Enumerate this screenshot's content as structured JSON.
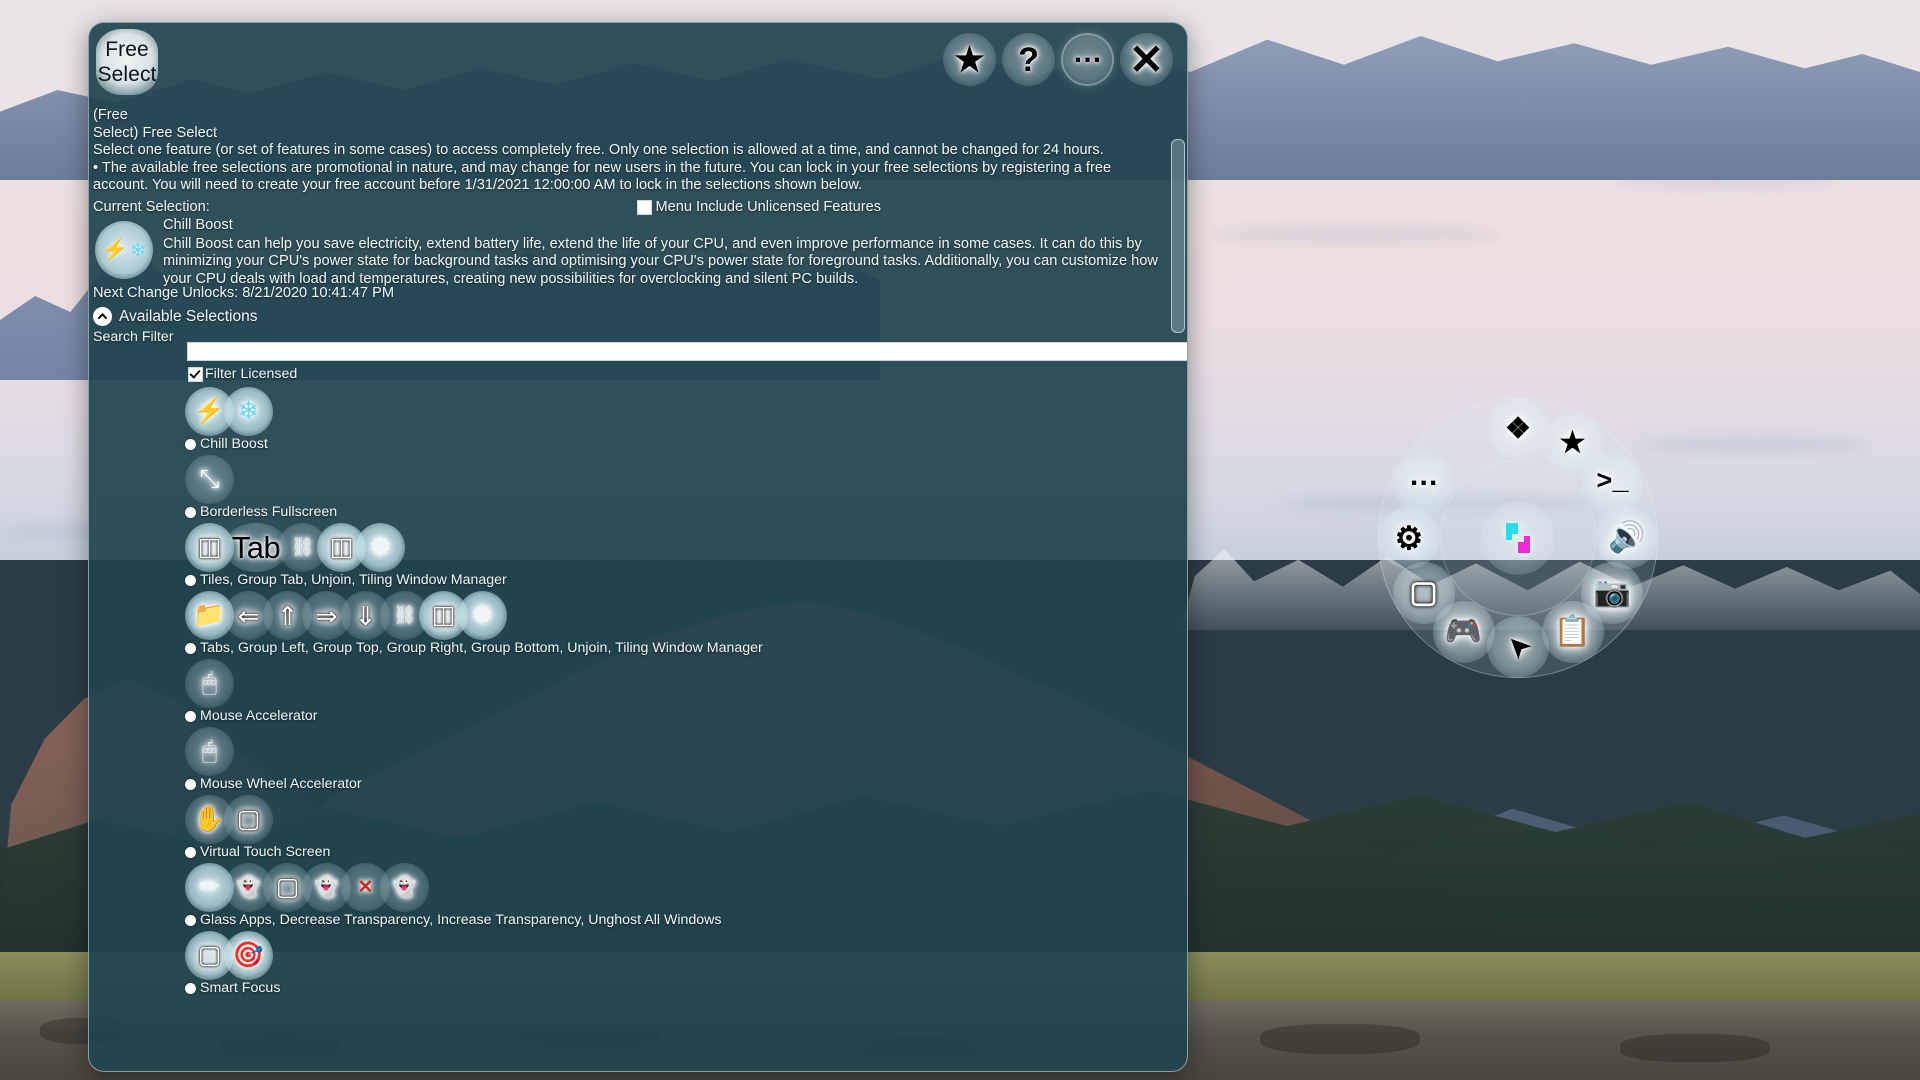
{
  "window": {
    "badge_line1": "Free",
    "badge_line2": "Select",
    "buttons": [
      {
        "name": "favorite",
        "icon": "star-icon",
        "glyph": "★"
      },
      {
        "name": "help",
        "icon": "question-mark-icon",
        "glyph": "?"
      },
      {
        "name": "more-options",
        "icon": "ellipsis-icon",
        "glyph": "…"
      },
      {
        "name": "close",
        "icon": "close-icon",
        "glyph": "✕"
      }
    ]
  },
  "intro": {
    "breadcrumb_line1": "(Free",
    "breadcrumb_line2": "Select)  Free Select",
    "description": "Select one feature (or set of features in some cases) to access completely free.  Only one selection is allowed at a time, and cannot be changed for 24 hours.",
    "bullet": "• The available free selections are promotional in nature, and may change for new users in the future.  You can lock in your free selections by registering a free account.  You will need to create your free account before 1/31/2021 12:00:00 AM to lock in the selections shown below."
  },
  "current_selection": {
    "label": "Current Selection:",
    "unlicensed_checkbox": {
      "label": "Menu Include Unlicensed Features",
      "checked": false
    },
    "item_name": "Chill Boost",
    "item_icons": [
      "lightning-bolt-icon",
      "snowflake-icon"
    ],
    "item_description": "Chill Boost can help you save electricity, extend battery life, extend the life of your CPU, and even improve performance in some cases.  It can do this by minimizing your CPU's power state for background tasks and optimising your CPU's power state for foreground tasks.  Additionally, you can customize how your CPU deals with load and temperatures, creating new possibilities for overclocking and silent PC builds.",
    "next_change": "Next Change Unlocks: 8/21/2020 10:41:47 PM"
  },
  "available": {
    "header": "Available Selections",
    "search_label": "Search Filter",
    "search_value": "",
    "search_placeholder": "",
    "filter_licensed": {
      "label": "Filter Licensed",
      "checked": true
    },
    "items": [
      {
        "label": "Chill Boost",
        "selected": false,
        "icons": [
          {
            "glyph": "⚡",
            "name": "lightning-bolt-icon",
            "bg": "light"
          },
          {
            "glyph": "❄",
            "name": "snowflake-icon",
            "bg": "light"
          }
        ]
      },
      {
        "label": "Borderless Fullscreen",
        "selected": false,
        "icons": [
          {
            "glyph": "⤡",
            "name": "diagonal-resize-arrows-icon",
            "bg": "dim"
          }
        ]
      },
      {
        "label": "Tiles, Group Tab, Unjoin, Tiling Window Manager",
        "selected": false,
        "icons": [
          {
            "glyph": "◫",
            "name": "split-panes-icon",
            "bg": "light"
          },
          {
            "glyph": "TAB-TEXT",
            "name": "tab-label-icon",
            "bg": "dim"
          },
          {
            "glyph": "⛓",
            "name": "chain-link-icon",
            "bg": "dim"
          },
          {
            "glyph": "◫",
            "name": "split-panes-icon",
            "bg": "light"
          },
          {
            "glyph": "⚙",
            "name": "gear-icon",
            "bg": "light"
          }
        ]
      },
      {
        "label": "Tabs, Group Left, Group Top, Group Right, Group Bottom, Unjoin, Tiling Window Manager",
        "selected": false,
        "icons": [
          {
            "glyph": "📁",
            "name": "folder-tabs-icon",
            "bg": "light"
          },
          {
            "glyph": "⇐",
            "name": "arrow-left-icon",
            "bg": "dim"
          },
          {
            "glyph": "⇑",
            "name": "arrow-up-icon",
            "bg": "dim"
          },
          {
            "glyph": "⇒",
            "name": "arrow-right-icon",
            "bg": "dim"
          },
          {
            "glyph": "⇓",
            "name": "arrow-down-icon",
            "bg": "dim"
          },
          {
            "glyph": "⛓",
            "name": "chain-link-icon",
            "bg": "dim"
          },
          {
            "glyph": "◫",
            "name": "split-panes-icon",
            "bg": "light"
          },
          {
            "glyph": "⚙",
            "name": "gear-icon",
            "bg": "light"
          }
        ]
      },
      {
        "label": "Mouse Accelerator",
        "selected": false,
        "icons": [
          {
            "glyph": "🖱",
            "name": "mouse-speed-icon",
            "bg": "dim"
          }
        ]
      },
      {
        "label": "Mouse Wheel Accelerator",
        "selected": false,
        "icons": [
          {
            "glyph": "🖱",
            "name": "mouse-wheel-speed-icon",
            "bg": "dim"
          }
        ]
      },
      {
        "label": "Virtual Touch Screen",
        "selected": false,
        "icons": [
          {
            "glyph": "✋",
            "name": "hand-icon",
            "bg": "dim"
          },
          {
            "glyph": "▢",
            "name": "screen-icon",
            "bg": "dim"
          }
        ]
      },
      {
        "label": "Glass Apps, Decrease Transparency, Increase Transparency, Unghost All Windows",
        "selected": false,
        "icons": [
          {
            "glyph": "✏",
            "name": "pencil-icon",
            "bg": "light"
          },
          {
            "glyph": "👻",
            "name": "ghost-icon",
            "bg": "dim"
          },
          {
            "glyph": "▢",
            "name": "window-icon",
            "bg": "dim"
          },
          {
            "glyph": "👻",
            "name": "ghost-icon",
            "bg": "dim"
          },
          {
            "glyph": "✕",
            "name": "red-x-icon",
            "bg": "dim"
          },
          {
            "glyph": "👻",
            "name": "ghost-icon",
            "bg": "dim"
          }
        ]
      },
      {
        "label": "Smart Focus",
        "selected": false,
        "icons": [
          {
            "glyph": "▢",
            "name": "window-icon",
            "bg": "light"
          },
          {
            "glyph": "🎯",
            "name": "target-dart-icon",
            "bg": "light"
          }
        ]
      }
    ]
  },
  "radial_menu": {
    "center_icon": "app-logo-icon",
    "items": [
      {
        "name": "move-icon",
        "glyph": "❖",
        "angle": 0
      },
      {
        "name": "favorites-star-icon",
        "glyph": "★",
        "angle": 30
      },
      {
        "name": "terminal-icon",
        "glyph": ">_",
        "angle": 60
      },
      {
        "name": "volume-speaker-icon",
        "glyph": "🔊",
        "angle": 90
      },
      {
        "name": "camera-icon",
        "glyph": "📷",
        "angle": 120
      },
      {
        "name": "clipboard-icon",
        "glyph": "📋",
        "angle": 150
      },
      {
        "name": "cursor-pointer-icon",
        "glyph": "➤",
        "angle": 180
      },
      {
        "name": "gamepad-icon",
        "glyph": "🎮",
        "angle": 210
      },
      {
        "name": "window-icon",
        "glyph": "▢",
        "angle": 240
      },
      {
        "name": "settings-gears-icon",
        "glyph": "⚙",
        "angle": 270
      },
      {
        "name": "more-ellipsis-icon",
        "glyph": "…",
        "angle": 300
      }
    ]
  },
  "colors": {
    "dialog_bg": "#20444f",
    "accent_cyan": "#22e0f0",
    "accent_magenta": "#ee2ad8",
    "text": "#f2f7f8"
  }
}
